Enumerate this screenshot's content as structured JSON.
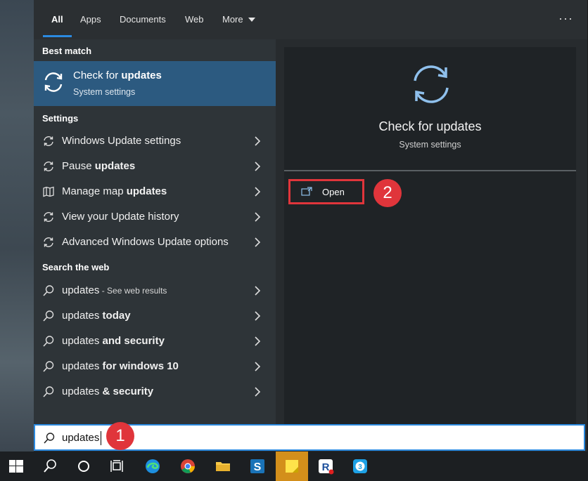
{
  "tabs": {
    "items": [
      {
        "label": "All",
        "active": true
      },
      {
        "label": "Apps"
      },
      {
        "label": "Documents"
      },
      {
        "label": "Web"
      },
      {
        "label": "More"
      }
    ],
    "more_icon": "ellipsis-icon",
    "close_icon": "close-icon"
  },
  "left": {
    "best_match_header": "Best match",
    "best_match": {
      "title_pre": "Check for ",
      "title_bold": "updates",
      "subtitle": "System settings",
      "icon": "refresh-icon"
    },
    "settings_header": "Settings",
    "settings_items": [
      {
        "pre": "Windows Update settings",
        "bold": "",
        "icon": "refresh-icon"
      },
      {
        "pre": "Pause ",
        "bold": "updates",
        "icon": "refresh-icon"
      },
      {
        "pre": "Manage map ",
        "bold": "updates",
        "icon": "map-icon"
      },
      {
        "pre": "View your Update history",
        "bold": "",
        "icon": "refresh-icon"
      },
      {
        "pre": "Advanced Windows Update options",
        "bold": "",
        "icon": "refresh-icon"
      }
    ],
    "web_header": "Search the web",
    "web_items": [
      {
        "pre": "updates",
        "bold": "",
        "hint": " - See web results"
      },
      {
        "pre": "updates ",
        "bold": "today",
        "hint": ""
      },
      {
        "pre": "updates ",
        "bold": "and security",
        "hint": ""
      },
      {
        "pre": "updates ",
        "bold": "for windows 10",
        "hint": ""
      },
      {
        "pre": "updates ",
        "bold": "& security",
        "hint": ""
      }
    ]
  },
  "preview": {
    "title": "Check for updates",
    "subtitle": "System settings",
    "open_label": "Open",
    "open_icon": "open-window-icon"
  },
  "annotations": {
    "badge_1": "1",
    "badge_2": "2",
    "color": "#e0353b"
  },
  "search": {
    "value": "updates",
    "icon": "search-icon"
  },
  "taskbar": {
    "icons": [
      "windows-start-icon",
      "search-icon",
      "cortana-icon",
      "task-view-icon",
      "edge-icon",
      "chrome-icon",
      "file-explorer-icon",
      "sway-icon",
      "sticky-notes-icon",
      "app-r-icon",
      "app-3-icon"
    ]
  },
  "colors": {
    "accent": "#2b8ae0",
    "best_match_bg": "#2c5a80",
    "panel_bg": "#272b2e",
    "annotation": "#e0353b"
  }
}
